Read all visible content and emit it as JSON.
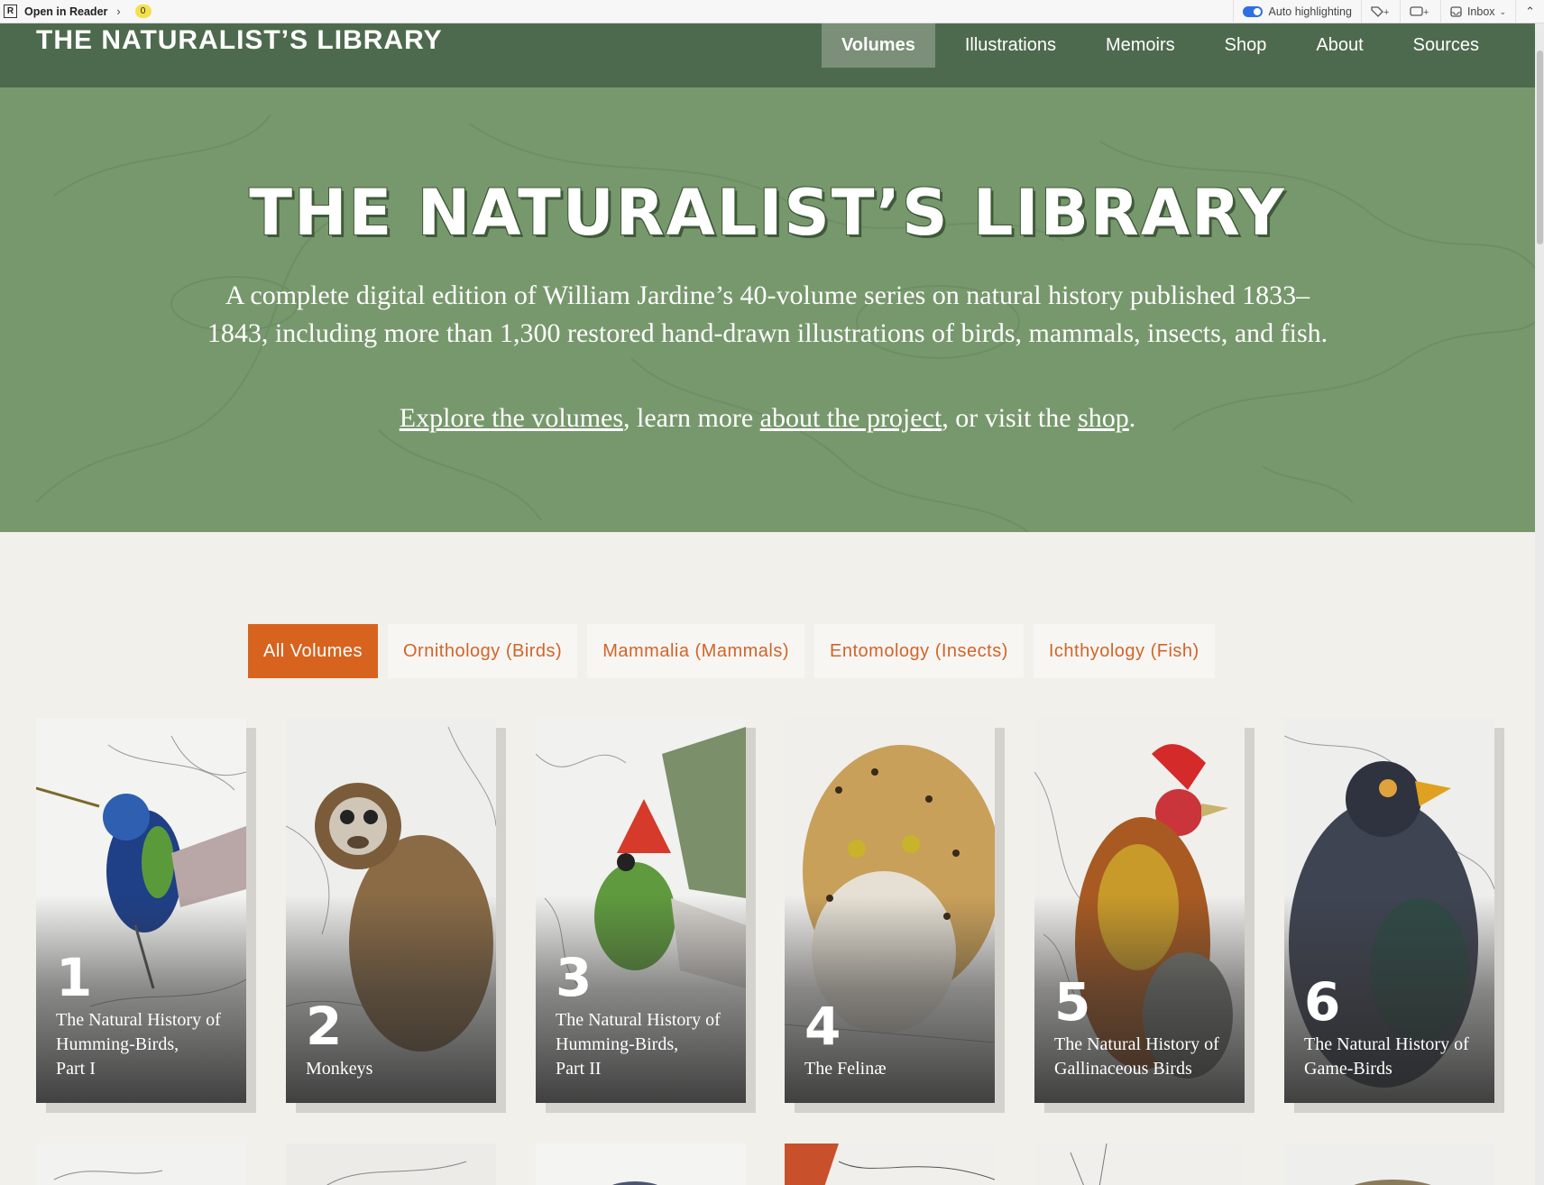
{
  "reader_bar": {
    "open_label": "Open in Reader",
    "count": "0",
    "auto_highlight": "Auto highlighting",
    "inbox": "Inbox"
  },
  "nav": {
    "brand": "THE NATURALIST’S LIBRARY",
    "links": [
      "Volumes",
      "Illustrations",
      "Memoirs",
      "Shop",
      "About",
      "Sources"
    ],
    "active": "Volumes"
  },
  "hero": {
    "title": "THE NATURALIST’S LIBRARY",
    "description": "A complete digital edition of William Jardine’s 40-volume series on natural history published 1833–1843, including more than 1,300 restored hand-drawn illustrations of birds, mammals, insects, and fish.",
    "links": {
      "explore": "Explore the volumes",
      "sep1": ", learn more ",
      "about": "about the project",
      "sep2": ", or visit the ",
      "shop": "shop",
      "end": "."
    }
  },
  "filters": [
    "All Volumes",
    "Ornithology (Birds)",
    "Mammalia (Mammals)",
    "Entomology (Insects)",
    "Ichthyology (Fish)"
  ],
  "volumes": [
    {
      "number": "1",
      "title_lines": [
        "The Natural History of",
        "Humming-Birds,",
        "Part I"
      ]
    },
    {
      "number": "2",
      "title_lines": [
        "Monkeys"
      ]
    },
    {
      "number": "3",
      "title_lines": [
        "The Natural History of",
        "Humming-Birds,",
        "Part II"
      ]
    },
    {
      "number": "4",
      "title_lines": [
        "The Felinæ"
      ]
    },
    {
      "number": "5",
      "title_lines": [
        "The Natural History of",
        "Gallinaceous Birds"
      ]
    },
    {
      "number": "6",
      "title_lines": [
        "The Natural History of",
        "Game-Birds"
      ]
    }
  ]
}
